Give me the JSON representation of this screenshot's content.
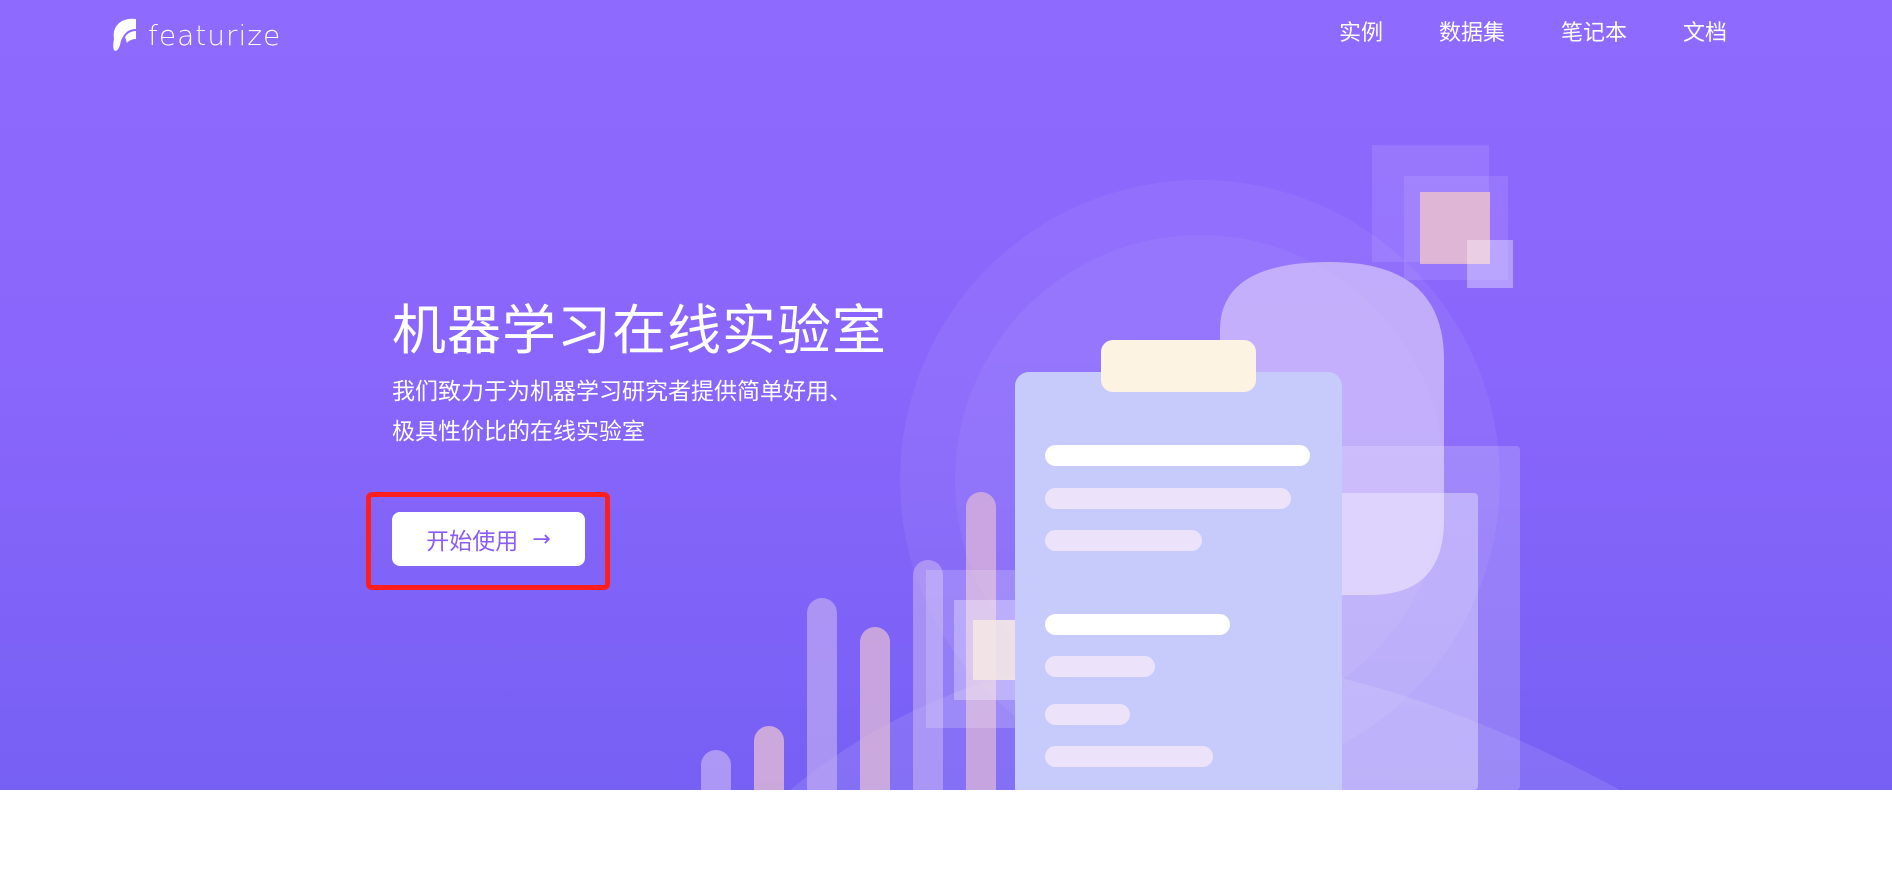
{
  "brand": {
    "name": "featurize"
  },
  "nav": {
    "items": [
      "实例",
      "数据集",
      "笔记本",
      "文档"
    ]
  },
  "hero": {
    "title": "机器学习在线实验室",
    "subtitle_line1": "我们致力于为机器学习研究者提供简单好用、",
    "subtitle_line2": "极具性价比的在线实验室",
    "cta_label": "开始使用",
    "cta_icon": "arrow-right-icon"
  },
  "colors": {
    "hero_bg": "#8f6afe",
    "accent": "#8b5cf6",
    "highlight": "#ff1e1e"
  }
}
